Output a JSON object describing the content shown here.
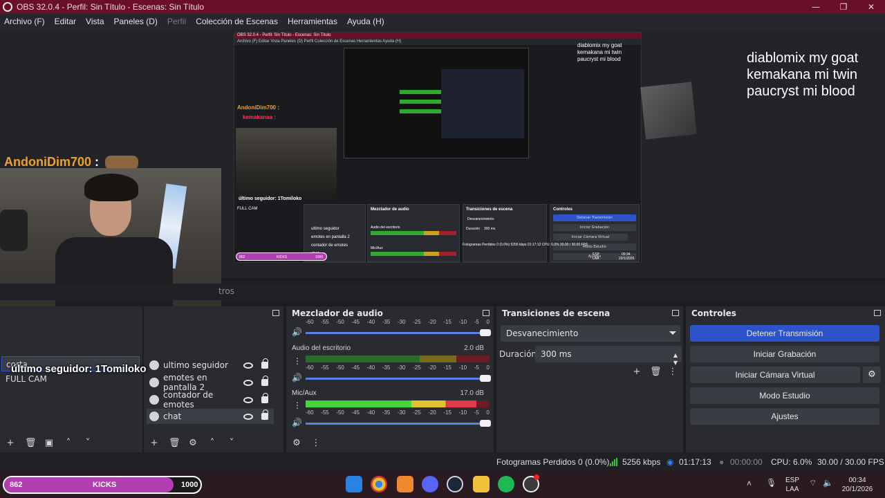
{
  "window": {
    "title": "OBS 32.0.4 - Perfil: Sin Título - Escenas: Sin Título",
    "minimize": "—",
    "maximize": "❐",
    "close": "✕"
  },
  "menu": [
    "Archivo (F)",
    "Editar",
    "Vista",
    "Paneles (D)",
    "Perfil",
    "Colección de Escenas",
    "Herramientas",
    "Ayuda (H)"
  ],
  "menu_disabled": "Perfil",
  "preview": {
    "overlay_lines": [
      "diablomix my goat",
      "kemakana mi twin",
      "paucryst mi blood"
    ],
    "chat": [
      {
        "user": "AndoniDim700",
        "sep": ":",
        "color": "#f0a028"
      },
      {
        "user": "kemakanaa",
        "sep": ":",
        "color": "#ff3a5a"
      }
    ],
    "follower_text": "último seguidor: 1Tomiloko",
    "nested": {
      "title": "OBS 32.0.4 - Perfil: Sin Título - Escenas: Sin Título",
      "menu": "Archivo (F)   Editar   Vista   Paneles (D)   Perfil   Colección de Escenas   Herramientas   Ayuda (H)",
      "overlay_lines": [
        "diablomix my goat",
        "kemakana mi twin",
        "paucryst mi blood"
      ],
      "chat1": "AndoniDim700 :",
      "chat2": "kemakanaa :",
      "follower": "último seguidor: 1Tomiloko",
      "fullcam": "FULL CAM",
      "mixer_title": "Mezclador de audio",
      "transitions_title": "Transiciones de escena",
      "controls_title": "Controles",
      "btn_stop": "Detener Transmisión",
      "btn_rec": "Iniciar Grabación",
      "btn_vcam": "Iniciar Cámara Virtual",
      "btn_studio": "Modo Estudio",
      "btn_settings": "Ajustes",
      "trans": "Desvanecimiento",
      "dur_label": "Duración",
      "dur": "300 ms",
      "desk": "Audio del escritorio",
      "mic": "Mic/Aux",
      "src1": "ultimo seguidor",
      "src2": "emotes en pantalla 2",
      "src3": "contador de emotes",
      "src4": "chat",
      "status": "Fotogramas Perdidos 0 (0.0%)   5256 kbps   01:17:12   CPU: 6.0%   30.00 / 30.00 FPS",
      "kicks_left": "862",
      "kicks_mid": "KICKS",
      "kicks_right": "1000",
      "lang1": "ESP",
      "lang2": "LAA",
      "time": "00:34",
      "date": "20/1/2026"
    }
  },
  "tabs": {
    "filters_partial": "tros"
  },
  "scenes": {
    "items": [
      {
        "label": "corta",
        "selected": true
      },
      {
        "label": "FULL CAM",
        "selected": false
      }
    ]
  },
  "sources": {
    "items": [
      {
        "label": "ultimo seguidor"
      },
      {
        "label": "emotes en pantalla 2"
      },
      {
        "label": "contador de emotes"
      },
      {
        "label": "chat",
        "selected": true
      }
    ]
  },
  "mixer": {
    "title": "Mezclador de audio",
    "ticks": [
      "-60",
      "-55",
      "-50",
      "-45",
      "-40",
      "-35",
      "-30",
      "-25",
      "-20",
      "-15",
      "-10",
      "-5",
      "0"
    ],
    "tracks": [
      {
        "name": "Audio del escritorio",
        "db": "2.0 dB",
        "level": 0
      },
      {
        "name": "Mic/Aux",
        "db": "17.0 dB",
        "level": 0.93
      }
    ]
  },
  "transitions": {
    "title": "Transiciones de escena",
    "selected": "Desvanecimiento",
    "duration_label": "Duración",
    "duration": "300 ms"
  },
  "controls": {
    "title": "Controles",
    "stop_stream": "Detener Transmisión",
    "start_recording": "Iniciar Grabación",
    "start_virtual_cam": "Iniciar Cámara Virtual",
    "studio_mode": "Modo Estudio",
    "settings": "Ajustes"
  },
  "status": {
    "dropped_frames": "Fotogramas Perdidos 0 (0.0%)",
    "bitrate": "5256 kbps",
    "stream_time": "01:17:13",
    "rec_time": "00:00:00",
    "cpu": "CPU: 6.0%",
    "fps": "30.00 / 30.00 FPS",
    "colors": {
      "ok": "#35c43a",
      "live": "#2f7fff"
    }
  },
  "taskbar": {
    "kicks_left": "862",
    "kicks_label": "KICKS",
    "kicks_right": "1000",
    "kicks_progress": 0.862,
    "lang": "ESP",
    "layout": "LAA",
    "time": "00:34",
    "date": "20/1/2026",
    "apps": [
      "windows-start",
      "chrome",
      "fl-studio",
      "discord",
      "steam",
      "file-explorer",
      "spotify",
      "obs"
    ]
  },
  "colors": {
    "titlebar": "#6a0f2a",
    "accent_blue": "#2c54c8",
    "kicks_fill": "#b23fb0"
  }
}
